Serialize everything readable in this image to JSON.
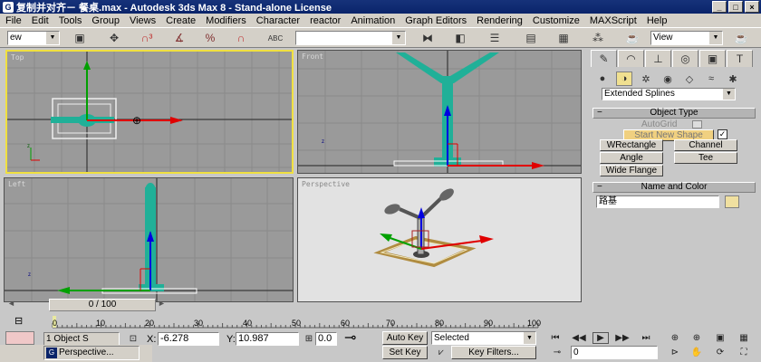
{
  "title_bar": {
    "title": "复制并对齐－ 餐桌.max - Autodesk 3ds Max 8  -  Stand-alone License",
    "app_icon_glyph": "G",
    "buttons": [
      "_",
      "□",
      "×"
    ]
  },
  "menu": [
    "File",
    "Edit",
    "Tools",
    "Group",
    "Views",
    "Create",
    "Modifiers",
    "Character",
    "reactor",
    "Animation",
    "Graph Editors",
    "Rendering",
    "Customize",
    "MAXScript",
    "Help"
  ],
  "toolbar": {
    "left_combo_value": "ew",
    "selection_set_combo_value": "",
    "view_combo_value": "View",
    "icons": [
      "select-filter-icon",
      "select-object-icon",
      "select-move-icon",
      "snap-3d-icon",
      "angle-snap-icon",
      "percent-snap-icon",
      "spinner-snap-icon",
      "abc-named-selection-icon",
      "mirror-icon",
      "align-icon",
      "layer-icon",
      "curve-editor-icon",
      "schematic-icon",
      "material-editor-icon",
      "render-teapot-icon",
      "quick-render-icon"
    ]
  },
  "viewports": {
    "top": {
      "label": "Top"
    },
    "front": {
      "label": "Front"
    },
    "left": {
      "label": "Left"
    },
    "perspective": {
      "label": "Perspective"
    }
  },
  "command_panel": {
    "tabs": [
      "create-tab",
      "modify-tab",
      "hierarchy-tab",
      "motion-tab",
      "display-tab",
      "utilities-tab"
    ],
    "category_dropdown": "Extended Splines",
    "object_type": {
      "header": "Object Type",
      "autogrid_label": "AutoGrid",
      "start_new_shape_label": "Start New Shape",
      "buttons": [
        "WRectangle",
        "Channel",
        "Angle",
        "Tee",
        "Wide Flange"
      ]
    },
    "name_and_color": {
      "header": "Name and Color",
      "name_value": "路基",
      "color": "#f0e0a0"
    }
  },
  "timeline": {
    "slider_label": "0 / 100",
    "ticks": [
      "0",
      "10",
      "20",
      "30",
      "40",
      "50",
      "60",
      "70",
      "80",
      "90",
      "100"
    ]
  },
  "status": {
    "selection_info": "1 Object S",
    "x_label": "X:",
    "x_value": "-6.278",
    "y_label": "Y:",
    "y_value": "10.987",
    "z_value": "0.0",
    "auto_key": "Auto Key",
    "set_key": "Set Key",
    "key_mode_value": "Selected",
    "key_filters": "Key Filters...",
    "frame_value": "0"
  },
  "taskbar": {
    "item_label": "Perspective..."
  },
  "colors": {
    "lamp": "#20b098",
    "selection": "#e8e040",
    "axis_red": "#e00000",
    "axis_green": "#00a000",
    "axis_blue": "#0000e0"
  }
}
